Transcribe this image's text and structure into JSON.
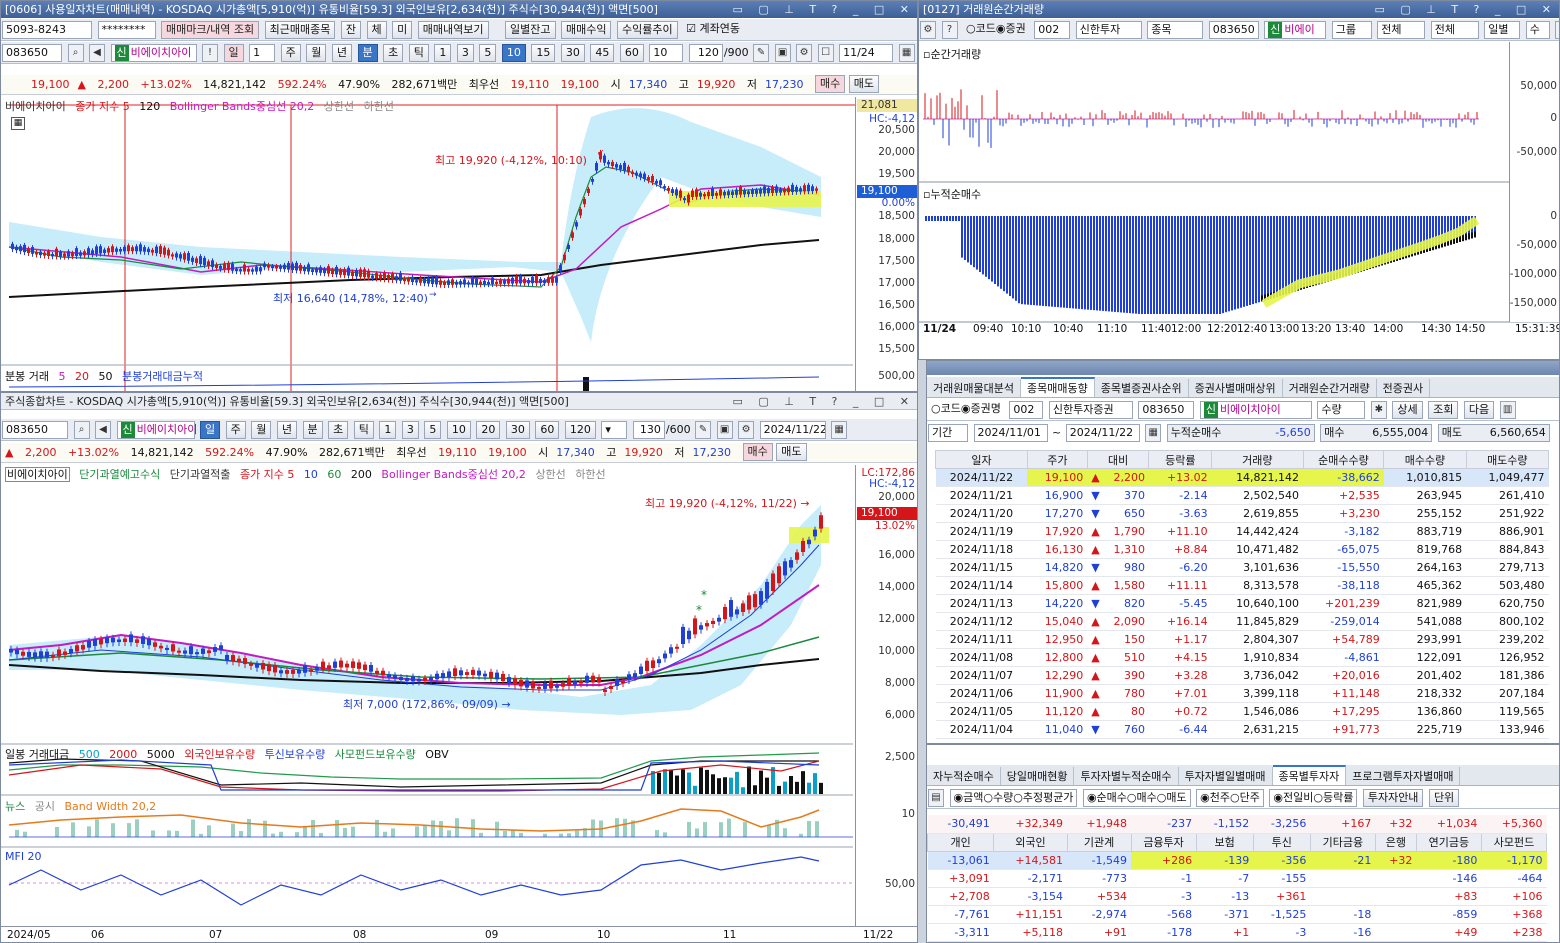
{
  "w1": {
    "title": "[0606] 사용일자차트(매매내역) - KOSDAQ 시가총액[5,910(억)] 유통비율[59.3] 외국인보유[2,634(천)] 주식수[30,944(천)] 액면[500]",
    "account": "5093-8243",
    "password": "********",
    "btns": [
      "매매마크/내역 조회",
      "최근매매종목",
      "잔",
      "체",
      "미",
      "매매내역보기",
      "일별잔고",
      "매매수익",
      "수익률추이"
    ],
    "chk": "계좌연동",
    "code": "083650",
    "stock": "비에이치아이",
    "sin": "신",
    "periods": [
      "일",
      "1",
      "주",
      "월",
      "년",
      "분",
      "초",
      "틱",
      "1",
      "3",
      "5",
      "10",
      "15",
      "30",
      "45",
      "60",
      "10"
    ],
    "count": "120",
    "countmax": "/900",
    "date": "11/24",
    "price": {
      "p": "19,100",
      "chg": "2,200",
      "pct": "+13.02%",
      "vol": "14,821,142",
      "volpct": "592.24%",
      "rate": "47.90%",
      "amt": "282,671백만",
      "pref": "최우선",
      "bid": "19,110",
      "ask": "19,100",
      "o_l": "시",
      "o": "17,340",
      "h_l": "고",
      "h": "19,920",
      "l_l": "저",
      "l": "17,230",
      "buy": "매수",
      "sell": "매도"
    },
    "legend": [
      "비에이치아이",
      "종가 지수 5",
      "120",
      "Bollinger Bands중심선 20,2",
      "상한선",
      "하한선"
    ],
    "yticks": [
      "20,500",
      "20,000",
      "19,500",
      "19,000",
      "18,500",
      "18,000",
      "17,500",
      "17,000",
      "16,500",
      "16,000",
      "15,500"
    ],
    "ytop": "21,081",
    "hc": "HC:-4,12",
    "tag": "19,100",
    "tagpct": "0.00%",
    "high": "최고 19,920 (-4,12%, 10:10)",
    "low": "최저 16,640 (14,78%, 12:40)",
    "vol_legend": [
      "분봉 거래",
      "5",
      "20",
      "50",
      "분봉거래대금누적"
    ],
    "vol_tick": "500,00"
  },
  "w2": {
    "title": "[0127] 거래원순간거래량",
    "radios": [
      "코드",
      "증권"
    ],
    "num": "002",
    "broker": "신한투자",
    "type": "종목",
    "code": "083650",
    "stock": "비에이",
    "sin": "신",
    "sels": [
      "그룹",
      "전체",
      "전체",
      "일별",
      "수"
    ],
    "top_label": "순간거래량",
    "bot_label": "누적순매수",
    "top_ticks": [
      "50,000",
      "0",
      "-50,000"
    ],
    "bot_ticks": [
      "0",
      "-50,000",
      "-100,000",
      "-150,000"
    ],
    "times": [
      "11/24",
      "09:40",
      "10:10",
      "10:40",
      "11:10",
      "11:40",
      "12:00",
      "12:20",
      "12:40",
      "13:00",
      "13:20",
      "13:40",
      "14:00",
      "14:30",
      "14:50",
      "15:31:39"
    ]
  },
  "w3": {
    "title": "주식종합차트 - KOSDAQ 시가총액[5,910(억)] 유통비율[59.3] 외국인보유[2,634(천)] 주식수[30,944(천)] 액면[500]",
    "code": "083650",
    "stock": "비에이치아이",
    "sin": "신",
    "periods": [
      "일",
      "주",
      "월",
      "년",
      "분",
      "초",
      "틱",
      "1",
      "3",
      "5",
      "10",
      "20",
      "30",
      "60",
      "120"
    ],
    "count": "130",
    "countmax": "/600",
    "date": "2024/11/22",
    "price": {
      "tri": "▲",
      "chg": "2,200",
      "pct": "+13.02%",
      "vol": "14,821,142",
      "volpct": "592.24%",
      "rate": "47.90%",
      "amt": "282,671백만",
      "pref": "최우선",
      "bid": "19,110",
      "ask": "19,100",
      "o_l": "시",
      "o": "17,340",
      "h_l": "고",
      "h": "19,920",
      "l_l": "저",
      "l": "17,230",
      "buy": "매수",
      "sell": "매도"
    },
    "legend": [
      "비에이치아이",
      "단기과열예고수식",
      "단기과열적출",
      "종가 지수 5",
      "10",
      "60",
      "200",
      "Bollinger Bands중심선 20,2",
      "상한선",
      "하한선"
    ],
    "lc": "LC:172,86",
    "hc": "HC:-4,12",
    "yticks": [
      "20,000",
      "18,000",
      "16,000",
      "14,000",
      "12,000",
      "10,000",
      "8,000",
      "6,000"
    ],
    "tag": "19,100",
    "tagpct": "13.02%",
    "high": "최고 19,920 (-4,12%, 11/22)",
    "low": "최저 7,000 (172,86%, 09/09)",
    "p2_legend": [
      "일봉 거래대금",
      "500",
      "2000",
      "5000",
      "외국인보유수량",
      "투신보유수량",
      "사모펀드보유수량",
      "OBV"
    ],
    "p2_tick": "2,500",
    "p3_legend": [
      "뉴스",
      "공시",
      "Band Width 20,2"
    ],
    "p3_tick": "10",
    "p4_legend": [
      "MFI 20"
    ],
    "p4_tick": "50,00",
    "xlabels": [
      "2024/05",
      "06",
      "07",
      "08",
      "09",
      "10",
      "11",
      "11/22"
    ]
  },
  "w4": {
    "tabs": [
      "거래원매물대분석",
      "종목매매동향",
      "종목별증권사순위",
      "증권사별매매상위",
      "거래원순간거래량",
      "전증권사"
    ],
    "radios": [
      "코드",
      "증권명"
    ],
    "num": "002",
    "broker": "신한투자증권",
    "code": "083650",
    "stock": "비에이치아이",
    "sin": "신",
    "qty": "수량",
    "btns": [
      "상세",
      "조회",
      "다음"
    ],
    "period_l": "기간",
    "from": "2024/11/01",
    "to": "2024/11/22",
    "net_l": "누적순매수",
    "net": "-5,650",
    "buy_l": "매수",
    "buy": "6,555,004",
    "sell_l": "매도",
    "sell": "6,560,654",
    "cols": [
      "일자",
      "주가",
      "대비",
      "등락률",
      "거래량",
      "순매수수량",
      "매수수량",
      "매도수량"
    ],
    "rows": [
      [
        "2024/11/22",
        "19,100",
        "▲",
        "2,200",
        "+13.02",
        "14,821,142",
        "-38,662",
        "1,010,815",
        "1,049,477"
      ],
      [
        "2024/11/21",
        "16,900",
        "▼",
        "370",
        "-2.14",
        "2,502,540",
        "+2,535",
        "263,945",
        "261,410"
      ],
      [
        "2024/11/20",
        "17,270",
        "▼",
        "650",
        "-3.63",
        "2,619,855",
        "+3,230",
        "255,152",
        "251,922"
      ],
      [
        "2024/11/19",
        "17,920",
        "▲",
        "1,790",
        "+11.10",
        "14,442,424",
        "-3,182",
        "883,719",
        "886,901"
      ],
      [
        "2024/11/18",
        "16,130",
        "▲",
        "1,310",
        "+8.84",
        "10,471,482",
        "-65,075",
        "819,768",
        "884,843"
      ],
      [
        "2024/11/15",
        "14,820",
        "▼",
        "980",
        "-6.20",
        "3,101,636",
        "-15,550",
        "264,163",
        "279,713"
      ],
      [
        "2024/11/14",
        "15,800",
        "▲",
        "1,580",
        "+11.11",
        "8,313,578",
        "-38,118",
        "465,362",
        "503,480"
      ],
      [
        "2024/11/13",
        "14,220",
        "▼",
        "820",
        "-5.45",
        "10,640,100",
        "+201,239",
        "821,989",
        "620,750"
      ],
      [
        "2024/11/12",
        "15,040",
        "▲",
        "2,090",
        "+16.14",
        "11,845,829",
        "-259,014",
        "541,088",
        "800,102"
      ],
      [
        "2024/11/11",
        "12,950",
        "▲",
        "150",
        "+1.17",
        "2,804,307",
        "+54,789",
        "293,991",
        "239,202"
      ],
      [
        "2024/11/08",
        "12,800",
        "▲",
        "510",
        "+4.15",
        "1,910,834",
        "-4,861",
        "122,091",
        "126,952"
      ],
      [
        "2024/11/07",
        "12,290",
        "▲",
        "390",
        "+3.28",
        "3,736,042",
        "+20,016",
        "201,402",
        "181,386"
      ],
      [
        "2024/11/06",
        "11,900",
        "▲",
        "780",
        "+7.01",
        "3,399,118",
        "+11,148",
        "218,332",
        "207,184"
      ],
      [
        "2024/11/05",
        "11,120",
        "▲",
        "80",
        "+0.72",
        "1,546,086",
        "+17,295",
        "136,860",
        "119,565"
      ],
      [
        "2024/11/04",
        "11,040",
        "▼",
        "760",
        "-6.44",
        "2,631,215",
        "+91,773",
        "225,719",
        "133,946"
      ]
    ]
  },
  "w5": {
    "tabs": [
      "자누적순매수",
      "당일매매현황",
      "투자자별누적순매수",
      "투자자별일별매매",
      "종목별투자자",
      "프로그램투자자별매매"
    ],
    "radios1": [
      "금액",
      "수량",
      "추정평균가"
    ],
    "radios2": [
      "순매수",
      "매수",
      "매도"
    ],
    "radios3": [
      "천주",
      "단주"
    ],
    "radios4": [
      "전일비",
      "등락률"
    ],
    "btn": "투자자안내",
    "btn2": "단위",
    "sum": [
      "-30,491",
      "+32,349",
      "+1,948",
      "-237",
      "-1,152",
      "-3,256",
      "+167",
      "+32",
      "+1,034",
      "+5,360"
    ],
    "cols": [
      "개인",
      "외국인",
      "기관계",
      "금융투자",
      "보험",
      "투신",
      "기타금융",
      "은행",
      "연기금등",
      "사모펀드"
    ],
    "rows": [
      [
        "-13,061",
        "+14,581",
        "-1,549",
        "+286",
        "-139",
        "-356",
        "-21",
        "+32",
        "-180",
        "-1,170"
      ],
      [
        "+3,091",
        "-2,171",
        "-773",
        "-1",
        "-7",
        "-155",
        "",
        "",
        "-146",
        "-464"
      ],
      [
        "+2,708",
        "-3,154",
        "+534",
        "-3",
        "-13",
        "+361",
        "",
        "",
        "+83",
        "+106"
      ],
      [
        "-7,761",
        "+11,151",
        "-2,974",
        "-568",
        "-371",
        "-1,525",
        "-18",
        "",
        "-859",
        "+368"
      ],
      [
        "-3,311",
        "+5,118",
        "+91",
        "-178",
        "+1",
        "-3",
        "-16",
        "",
        "+49",
        "+238"
      ]
    ]
  },
  "colors": {
    "up": "#d4161b",
    "down": "#1f3fd6",
    "title": "#3d5f95",
    "band": "#c7ecfa",
    "highlight": "#e5f54c"
  }
}
